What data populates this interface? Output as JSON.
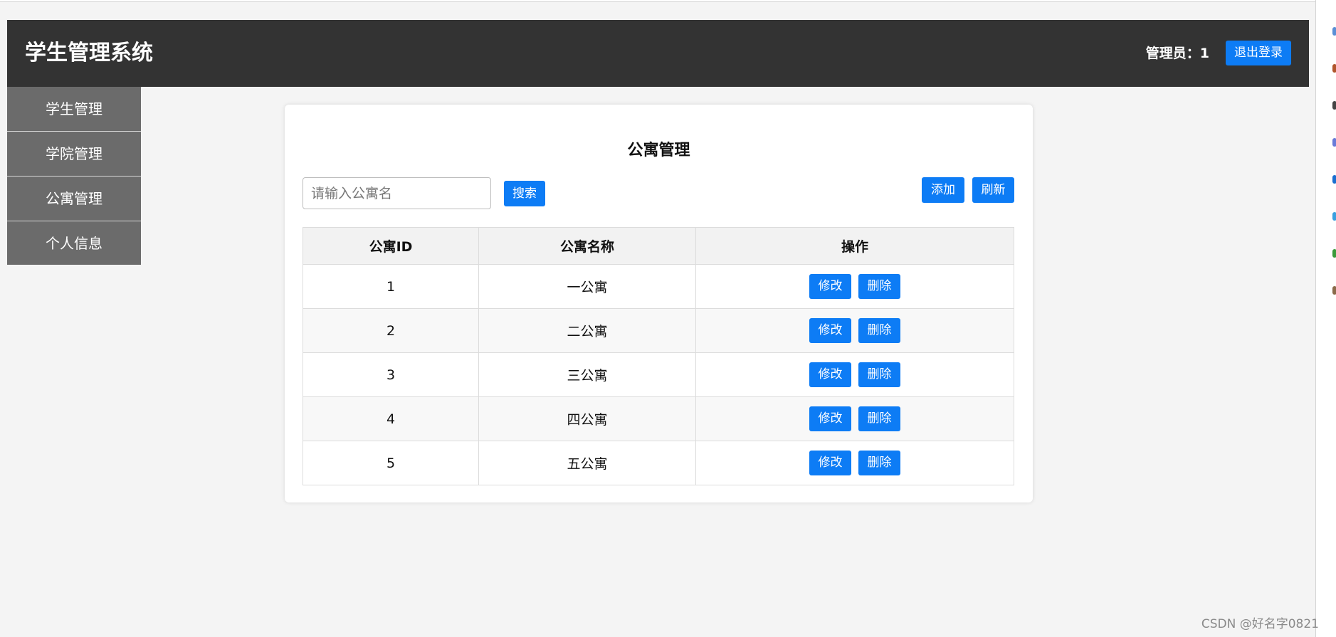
{
  "app": {
    "title": "学生管理系统"
  },
  "header": {
    "admin_label": "管理员：1",
    "logout_label": "退出登录"
  },
  "sidebar": {
    "items": [
      {
        "label": "学生管理"
      },
      {
        "label": "学院管理"
      },
      {
        "label": "公寓管理"
      },
      {
        "label": "个人信息"
      }
    ]
  },
  "main": {
    "title": "公寓管理",
    "search": {
      "placeholder": "请输入公寓名",
      "value": ""
    },
    "search_label": "搜索",
    "add_label": "添加",
    "refresh_label": "刷新",
    "table": {
      "headers": [
        "公寓ID",
        "公寓名称",
        "操作"
      ],
      "rows": [
        {
          "id": "1",
          "name": "一公寓"
        },
        {
          "id": "2",
          "name": "二公寓"
        },
        {
          "id": "3",
          "name": "三公寓"
        },
        {
          "id": "4",
          "name": "四公寓"
        },
        {
          "id": "5",
          "name": "五公寓"
        }
      ],
      "edit_label": "修改",
      "delete_label": "删除"
    }
  },
  "watermark": "CSDN @好名字0821",
  "colors": {
    "header_bg": "#333333",
    "sidebar_bg": "#6b6b6b",
    "accent": "#0d7cf5",
    "page_bg": "#f4f4f4"
  }
}
